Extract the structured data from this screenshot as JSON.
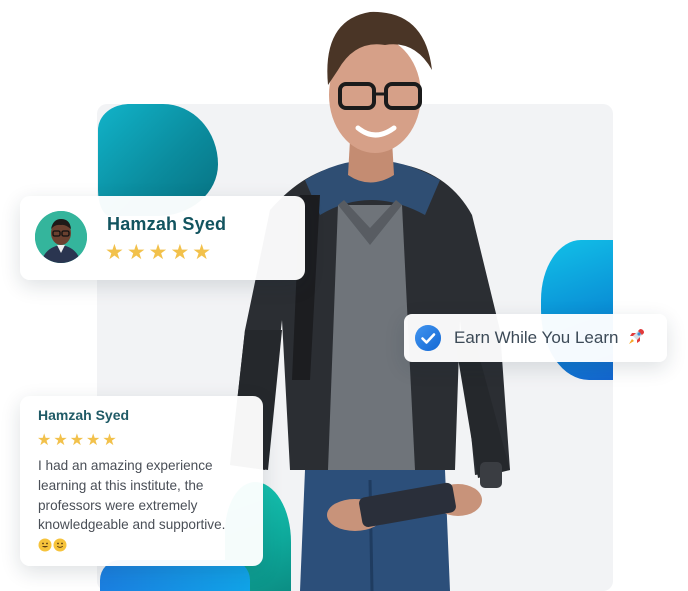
{
  "profile_card": {
    "name": "Hamzah Syed",
    "stars": "★★★★★",
    "rating": 5
  },
  "badge": {
    "text": "Earn While You Learn",
    "icon": "rocket-icon"
  },
  "review_card": {
    "name": "Hamzah Syed",
    "stars": "★★★★★",
    "rating": 5,
    "text": "I had an amazing experience learning at this institute, the professors were extremely knowledgeable and supportive."
  },
  "colors": {
    "name_teal": "#12545f",
    "star_gold": "#f2c14b",
    "check_blue": "#1877e6",
    "blob_teal": "#0b8c9e",
    "blob_blue": "#0a8fd6"
  }
}
